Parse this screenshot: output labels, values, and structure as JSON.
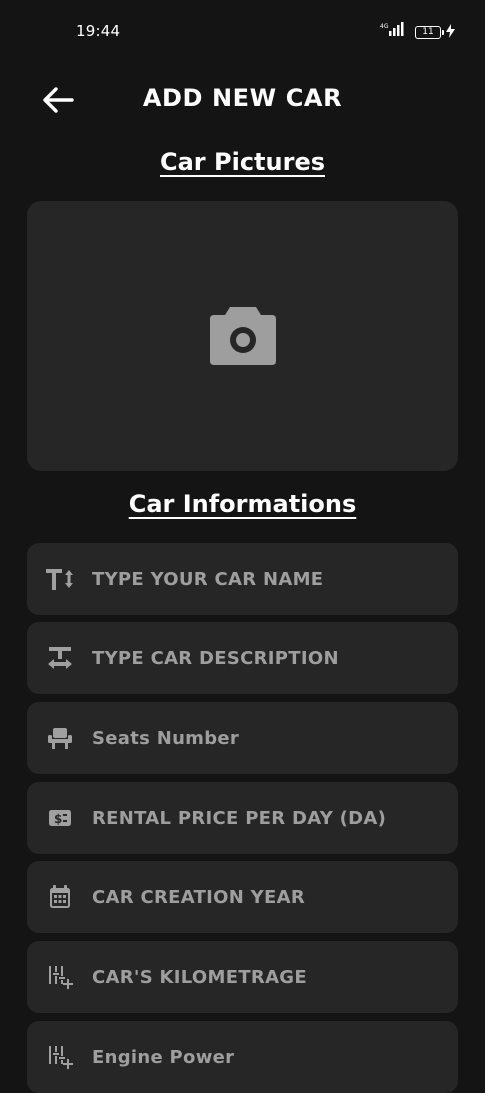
{
  "status_bar": {
    "time": "19:44",
    "network": "4G",
    "battery_level": "11"
  },
  "header": {
    "title": "ADD NEW CAR",
    "back_icon": "arrow-left-icon"
  },
  "pictures_section": {
    "heading": "Car Pictures",
    "upload_icon": "camera-icon"
  },
  "info_section": {
    "heading": "Car Informations",
    "fields": [
      {
        "icon": "text-size-icon",
        "placeholder": "TYPE YOUR CAR NAME"
      },
      {
        "icon": "text-description-icon",
        "placeholder": "TYPE CAR DESCRIPTION"
      },
      {
        "icon": "seat-icon",
        "placeholder": "Seats Number"
      },
      {
        "icon": "money-icon",
        "placeholder": "RENTAL PRICE PER DAY (DA)"
      },
      {
        "icon": "calendar-icon",
        "placeholder": "CAR CREATION YEAR"
      },
      {
        "icon": "kilometrage-icon",
        "placeholder": "CAR'S KILOMETRAGE"
      },
      {
        "icon": "engine-power-icon",
        "placeholder": "Engine Power"
      }
    ]
  },
  "colors": {
    "background": "#141414",
    "card": "#262626",
    "placeholder_text": "#9e9e9e",
    "icon": "#a0a0a0",
    "title_text": "#ffffff"
  }
}
